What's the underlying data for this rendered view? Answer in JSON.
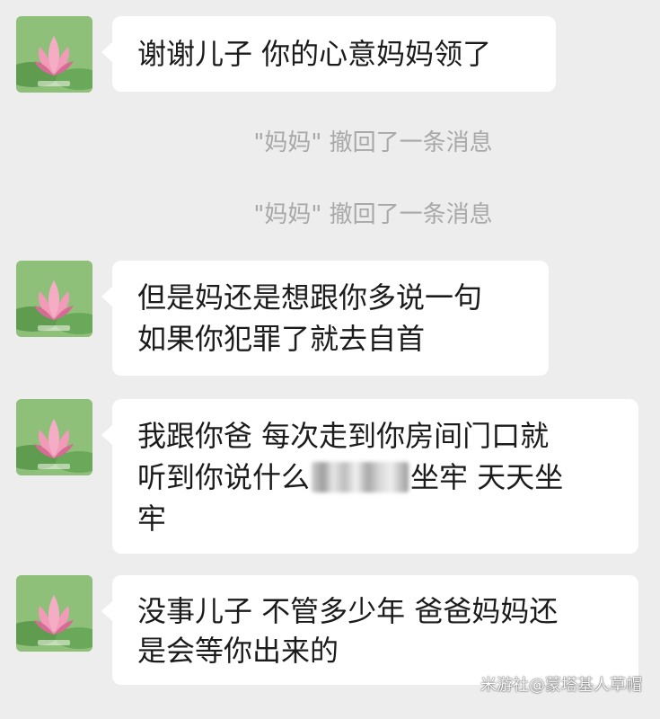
{
  "chat": {
    "messages": [
      {
        "lines": [
          "谢谢儿子  你的心意妈妈领了"
        ]
      },
      {
        "lines": [
          "但是妈还是想跟你多说一句",
          "如果你犯罪了就去自首"
        ]
      },
      {
        "lines_parts": {
          "line1": "我跟你爸  每次走到你房间门口就",
          "line2_before": "听到你说什么",
          "line2_after": "坐牢  天天坐",
          "line3": "牢"
        }
      },
      {
        "lines": [
          "没事儿子  不管多少年  爸爸妈妈还",
          "是会等你出来的"
        ]
      }
    ],
    "notices": [
      "\"妈妈\" 撤回了一条消息",
      "\"妈妈\" 撤回了一条消息"
    ]
  },
  "avatar": {
    "icon": "lotus-avatar-icon",
    "colors": {
      "background": "#8fc07a",
      "leaf": "#5f9c4f",
      "petal": "#f19bb8",
      "petal_dark": "#d66c94"
    }
  },
  "watermark": "米游社@蒙塔基人草帽",
  "colors": {
    "background": "#ededed",
    "bubble": "#ffffff",
    "text": "#1b1b1b",
    "notice_text": "#a8a8a8"
  }
}
